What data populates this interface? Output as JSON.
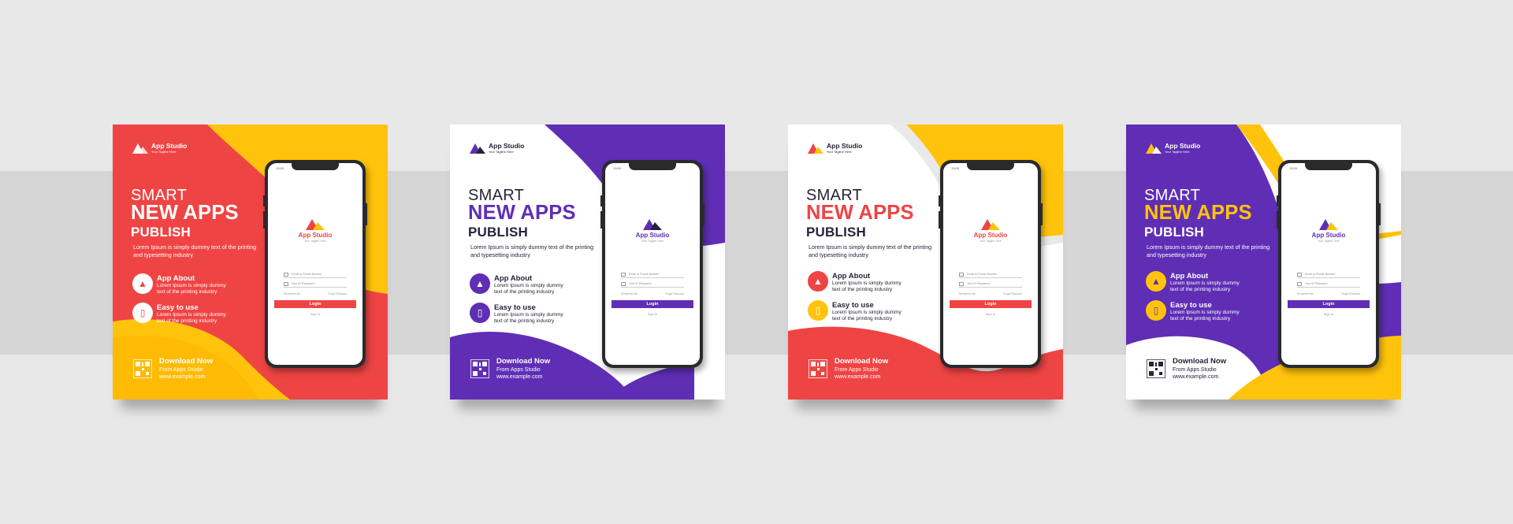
{
  "colors": {
    "red": "#ef4444",
    "yellow": "#ffc30b",
    "purple": "#5f2eb5",
    "dark": "#26233a",
    "white": "#ffffff"
  },
  "cards": [
    {
      "logo": {
        "brand": "App Studio",
        "tagline": "Your Tagline Here"
      },
      "headline": {
        "line1": "SMART",
        "line2": "NEW APPS",
        "line3": "PUBLISH"
      },
      "description": "Lorem Ipsum is simply dummy text of the printing and typesetting industry",
      "features": [
        {
          "icon": "chart-icon",
          "title": "App About",
          "text": "Lorem Ipsum is simply dummy text of the printing industry"
        },
        {
          "icon": "phone-icon",
          "title": "Easy to use",
          "text": "Lorem Ipsum is simply dummy text of the printing industry"
        }
      ],
      "download": {
        "title": "Download Now",
        "subtitle": "From Apps Studio",
        "url": "www.example.com"
      },
      "phone": {
        "time": "13:00",
        "brand": "App Studio",
        "tagline": "Your Tagline Here",
        "email_placeholder": "Email or Phone Number",
        "password_placeholder": "Your ID Password",
        "remember": "Remember Me",
        "forgot": "Forgot Password",
        "login": "Login",
        "signin": "Sign In"
      }
    },
    {
      "logo": {
        "brand": "App Studio",
        "tagline": "Your Tagline Here"
      },
      "headline": {
        "line1": "SMART",
        "line2": "NEW APPS",
        "line3": "PUBLISH"
      },
      "description": "Lorem Ipsum is simply dummy text of the printing and typesetting industry",
      "features": [
        {
          "icon": "chart-icon",
          "title": "App About",
          "text": "Lorem Ipsum is simply dummy text of the printing industry"
        },
        {
          "icon": "phone-icon",
          "title": "Easy to use",
          "text": "Lorem Ipsum is simply dummy text of the printing industry"
        }
      ],
      "download": {
        "title": "Download Now",
        "subtitle": "From Apps Studio",
        "url": "www.example.com"
      },
      "phone": {
        "time": "13:00",
        "brand": "App Studio",
        "tagline": "Your Tagline Here",
        "email_placeholder": "Email or Phone Number",
        "password_placeholder": "Your ID Password",
        "remember": "Remember Me",
        "forgot": "Forgot Password",
        "login": "Login",
        "signin": "Sign In"
      }
    },
    {
      "logo": {
        "brand": "App Studio",
        "tagline": "Your Tagline Here"
      },
      "headline": {
        "line1": "SMART",
        "line2": "NEW APPS",
        "line3": "PUBLISH"
      },
      "description": "Lorem Ipsum is simply dummy text of the printing and typesetting industry",
      "features": [
        {
          "icon": "chart-icon",
          "title": "App About",
          "text": "Lorem Ipsum is simply dummy text of the printing industry"
        },
        {
          "icon": "phone-icon",
          "title": "Easy to use",
          "text": "Lorem Ipsum is simply dummy text of the printing industry"
        }
      ],
      "download": {
        "title": "Download Now",
        "subtitle": "From Apps Studio",
        "url": "www.example.com"
      },
      "phone": {
        "time": "13:00",
        "brand": "App Studio",
        "tagline": "Your Tagline Here",
        "email_placeholder": "Email or Phone Number",
        "password_placeholder": "Your ID Password",
        "remember": "Remember Me",
        "forgot": "Forgot Password",
        "login": "Login",
        "signin": "Sign In"
      }
    },
    {
      "logo": {
        "brand": "App Studio",
        "tagline": "Your Tagline Here"
      },
      "headline": {
        "line1": "SMART",
        "line2": "NEW APPS",
        "line3": "PUBLISH"
      },
      "description": "Lorem Ipsum is simply dummy text of the printing and typesetting industry",
      "features": [
        {
          "icon": "chart-icon",
          "title": "App About",
          "text": "Lorem Ipsum is simply dummy text of the printing industry"
        },
        {
          "icon": "phone-icon",
          "title": "Easy to use",
          "text": "Lorem Ipsum is simply dummy text of the printing industry"
        }
      ],
      "download": {
        "title": "Download Now",
        "subtitle": "From Apps Studio",
        "url": "www.example.com"
      },
      "phone": {
        "time": "13:00",
        "brand": "App Studio",
        "tagline": "Your Tagline Here",
        "email_placeholder": "Email or Phone Number",
        "password_placeholder": "Your ID Password",
        "remember": "Remember Me",
        "forgot": "Forgot Password",
        "login": "Login",
        "signin": "Sign In"
      }
    }
  ]
}
